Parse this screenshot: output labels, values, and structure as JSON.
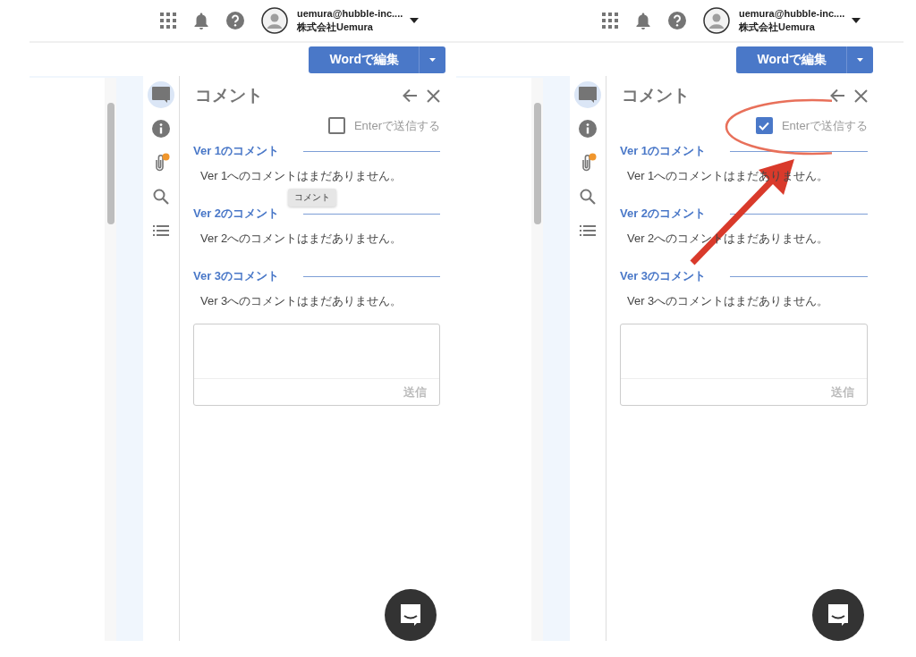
{
  "panels": [
    {
      "account": {
        "email": "uemura@hubble-inc....",
        "company": "株式会社Uemura"
      },
      "edit_button": "Wordで編集",
      "rail": [
        {
          "kind": "comment",
          "selected": true
        },
        {
          "kind": "info",
          "selected": false
        },
        {
          "kind": "attachment",
          "selected": false
        },
        {
          "kind": "search",
          "selected": false
        },
        {
          "kind": "list",
          "selected": false
        }
      ],
      "comments": {
        "title": "コメント",
        "enter_to_send": {
          "label": "Enterで送信する",
          "checked": false
        },
        "sections": [
          {
            "heading": "Ver 1のコメント",
            "message": "Ver 1へのコメントはまだありません。"
          },
          {
            "heading": "Ver 2のコメント",
            "message": "Ver 2へのコメントはまだありません。"
          },
          {
            "heading": "Ver 3のコメント",
            "message": "Ver 3へのコメントはまだありません。"
          }
        ],
        "send_label": "送信"
      },
      "tooltip": "コメント",
      "highlight": false
    },
    {
      "account": {
        "email": "uemura@hubble-inc....",
        "company": "株式会社Uemura"
      },
      "edit_button": "Wordで編集",
      "rail": [
        {
          "kind": "comment",
          "selected": true
        },
        {
          "kind": "info",
          "selected": false
        },
        {
          "kind": "attachment",
          "selected": false
        },
        {
          "kind": "search",
          "selected": false
        },
        {
          "kind": "list",
          "selected": false
        }
      ],
      "comments": {
        "title": "コメント",
        "enter_to_send": {
          "label": "Enterで送信する",
          "checked": true
        },
        "sections": [
          {
            "heading": "Ver 1のコメント",
            "message": "Ver 1へのコメントはまだありません。"
          },
          {
            "heading": "Ver 2のコメント",
            "message": "Ver 2へのコメントはまだありません。"
          },
          {
            "heading": "Ver 3のコメント",
            "message": "Ver 3へのコメントはまだありません。"
          }
        ],
        "send_label": "送信"
      },
      "highlight": true
    }
  ]
}
